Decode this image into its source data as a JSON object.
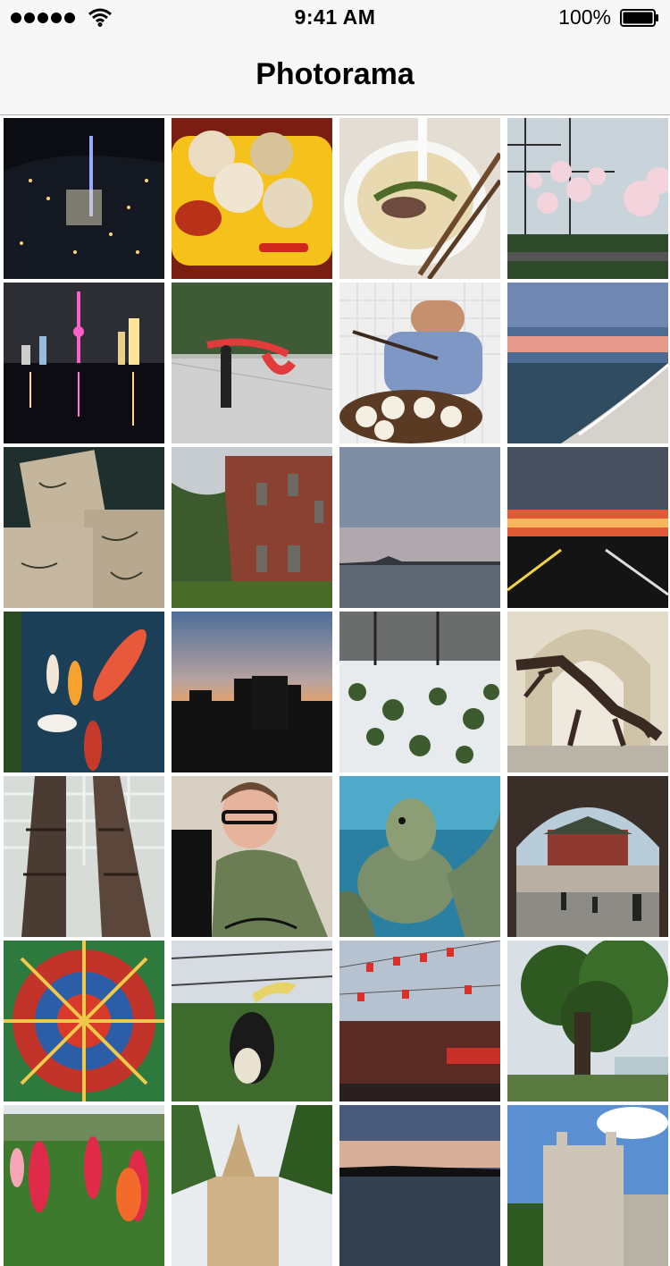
{
  "status": {
    "time": "9:41 AM",
    "battery": "100%"
  },
  "nav": {
    "title": "Photorama"
  },
  "colors": {
    "bar": "#f7f7f7",
    "separator": "#b2b2b2"
  },
  "photos": [
    "city-night-aerial",
    "dumplings-plate",
    "noodle-soup",
    "cherry-blossoms",
    "skyline-night",
    "park-ribbon-dancer",
    "man-eating-dumplings",
    "beach-sunset",
    "frogs-on-boards",
    "brick-building",
    "lake-dusk",
    "highway-sunset",
    "koi-fish",
    "city-silhouette-dusk",
    "snow-forest",
    "trex-skeleton",
    "totem-poles",
    "man-at-computer",
    "sea-turtle",
    "gate-tower-arch",
    "ornate-ceiling",
    "hornbill-bird",
    "festival-flags",
    "large-tree",
    "flowers-garden",
    "temple-spire",
    "lake-evening",
    "castle-building"
  ]
}
